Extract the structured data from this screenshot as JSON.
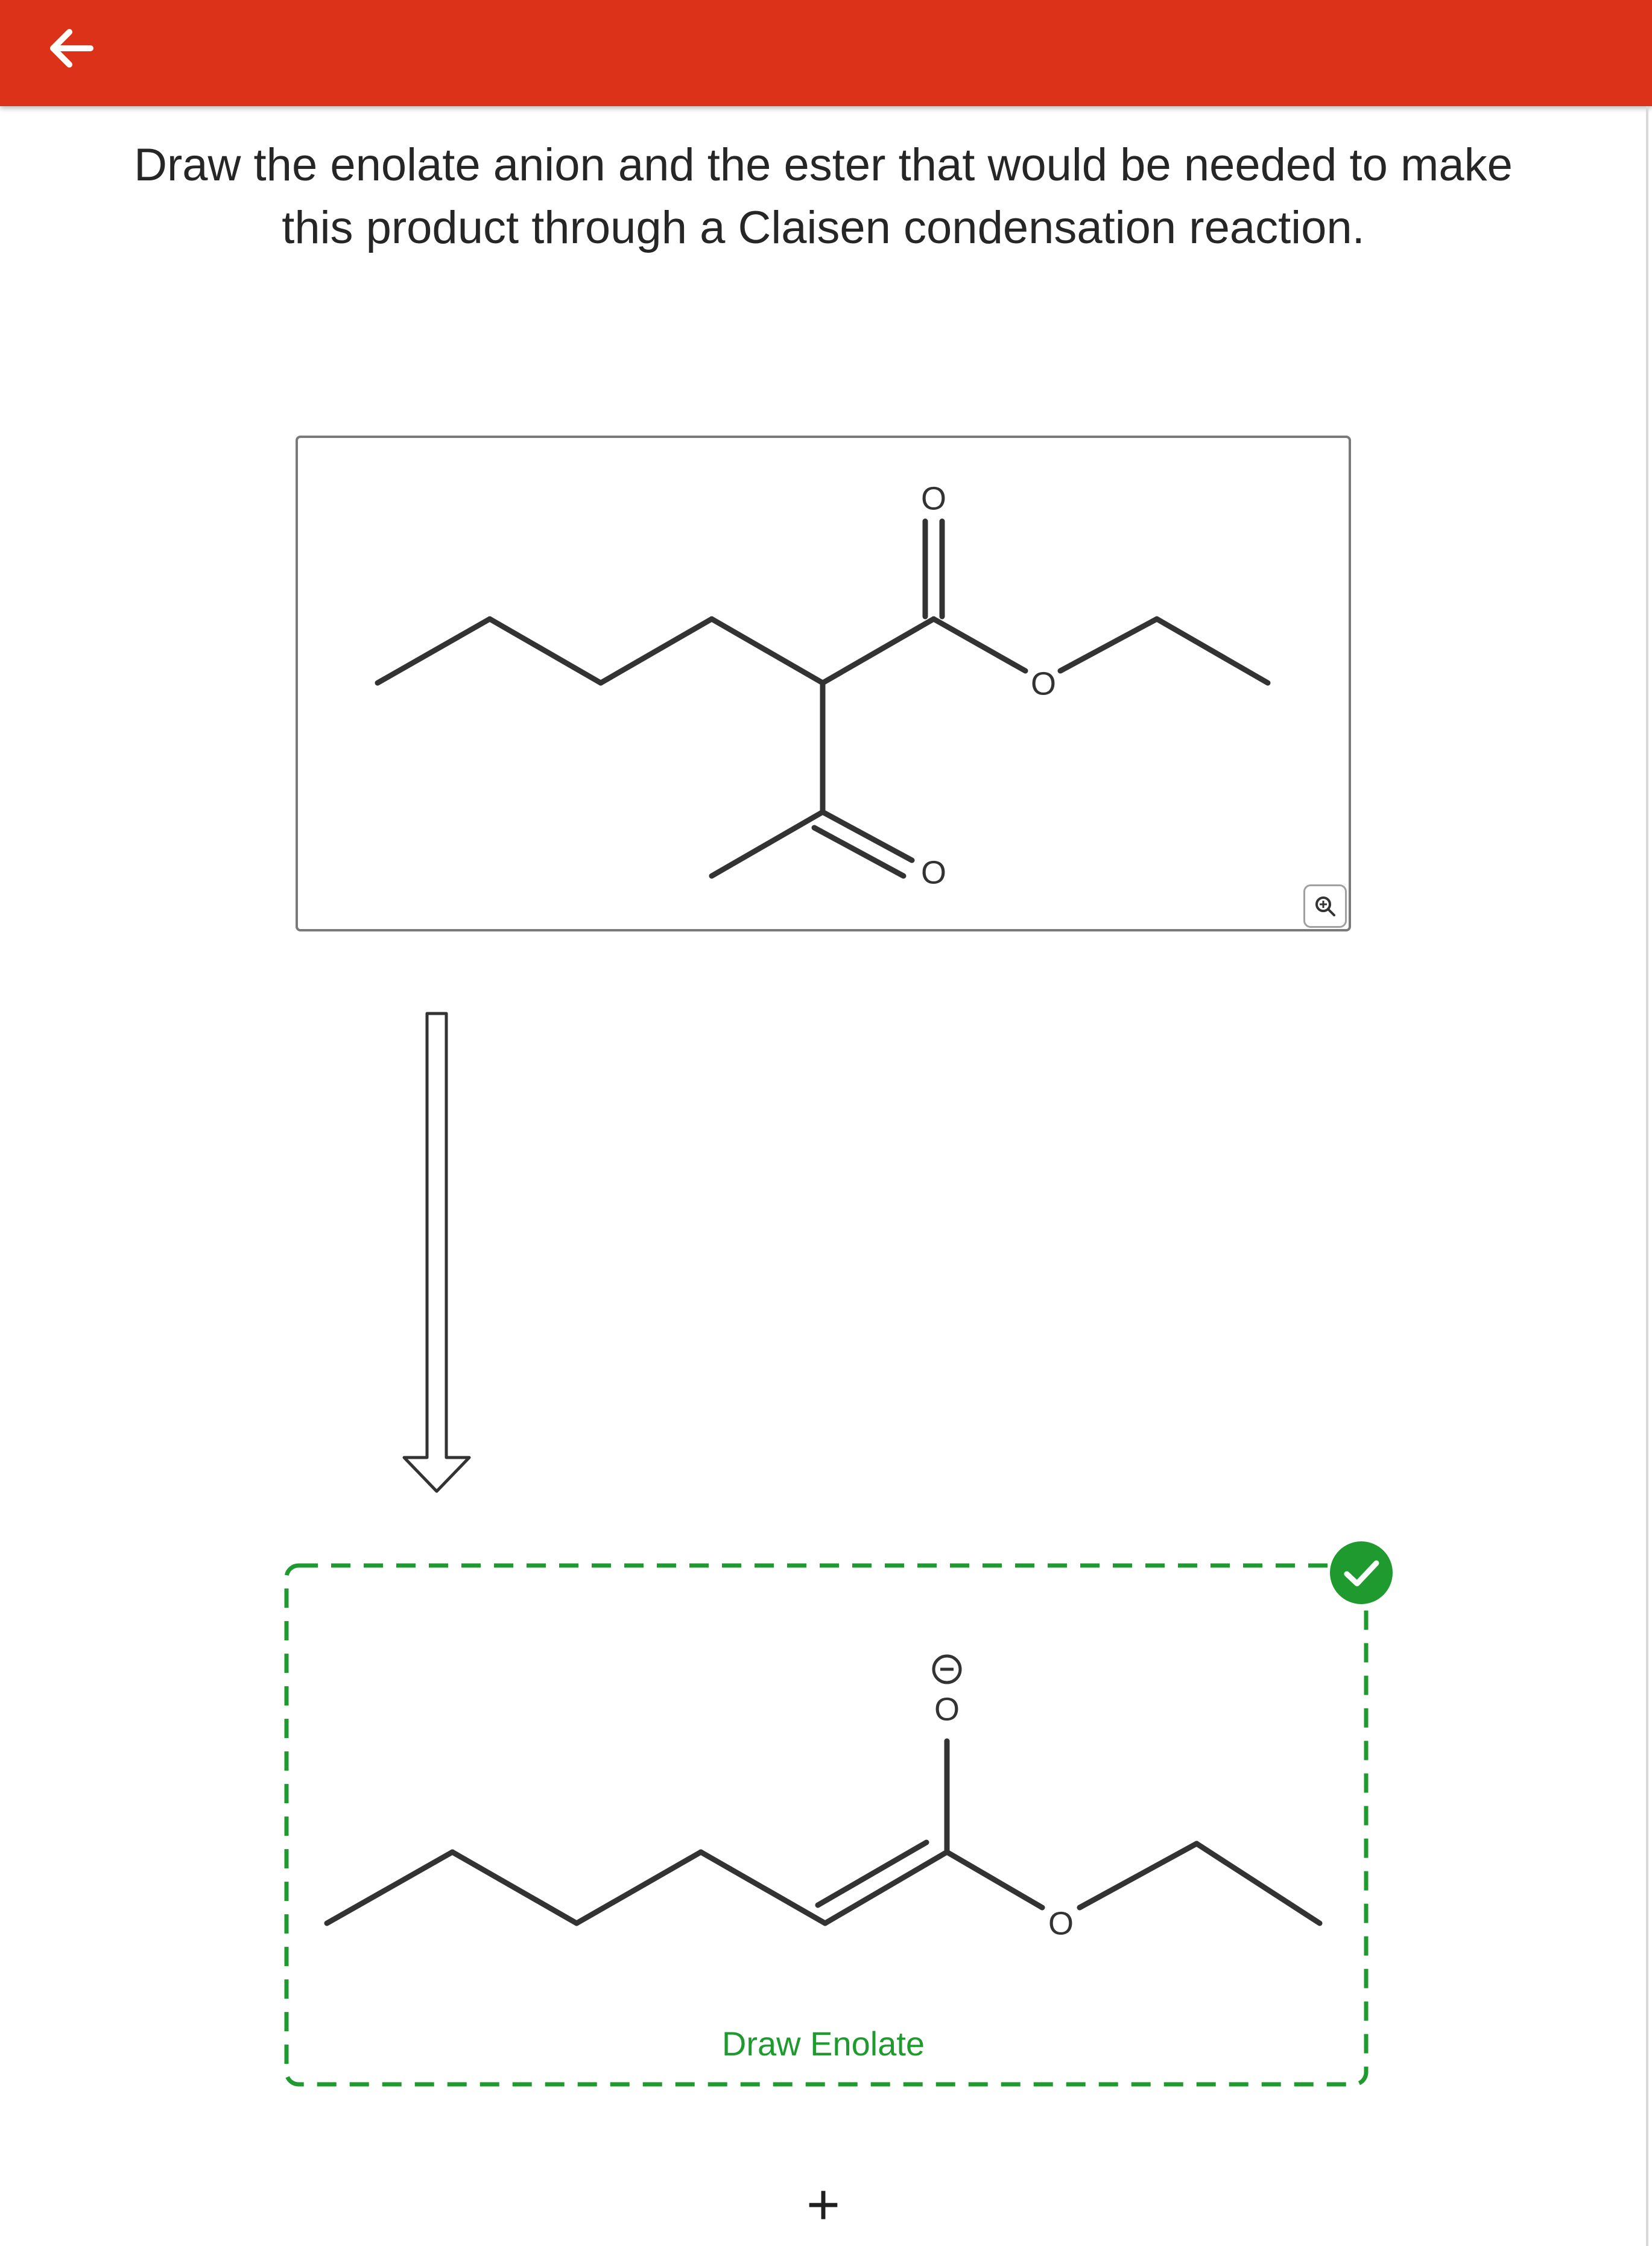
{
  "header": {
    "back_icon": "arrow-left-icon",
    "bar_color": "#dc3219"
  },
  "question": {
    "line1": "Draw the enolate anion and the ester that would be needed to make",
    "line2": "this product through a Claisen condensation reaction."
  },
  "product": {
    "atom_labels": [
      "O",
      "O",
      "O"
    ],
    "zoom_icon": "zoom-in-icon"
  },
  "enolate_answer": {
    "atom_labels": [
      "O",
      "O"
    ],
    "charge_symbol": "−",
    "status_icon": "check-icon",
    "status_color": "#1f9a2e",
    "draw_label": "Draw Enolate"
  },
  "plus": "+"
}
